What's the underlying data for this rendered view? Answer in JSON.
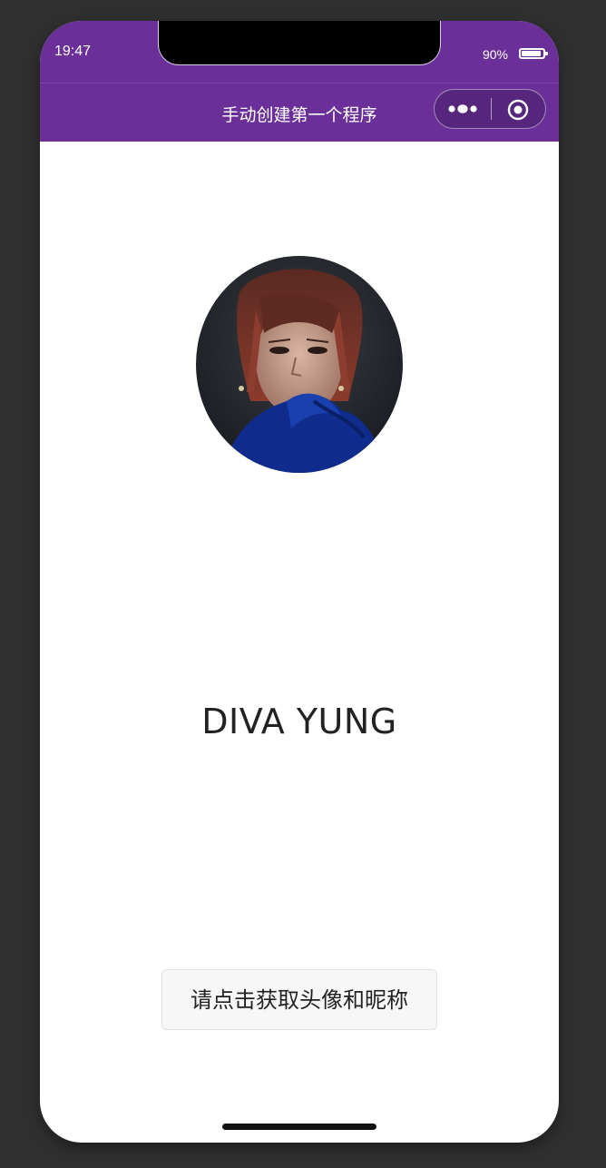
{
  "status_bar": {
    "time": "19:47",
    "battery_percent": "90%",
    "battery_level": 0.9
  },
  "nav_bar": {
    "title": "手动创建第一个程序",
    "more_icon": "more-dots-icon",
    "close_icon": "miniprogram-close-icon"
  },
  "profile": {
    "avatar_icon": "user-avatar-photo",
    "nickname": "DIVA YUNG"
  },
  "actions": {
    "get_profile_label": "请点击获取头像和昵称"
  },
  "colors": {
    "nav_background": "#6a2f99",
    "page_background": "#ffffff",
    "outer_background": "#2f2f2f",
    "button_background": "#f7f7f7"
  }
}
